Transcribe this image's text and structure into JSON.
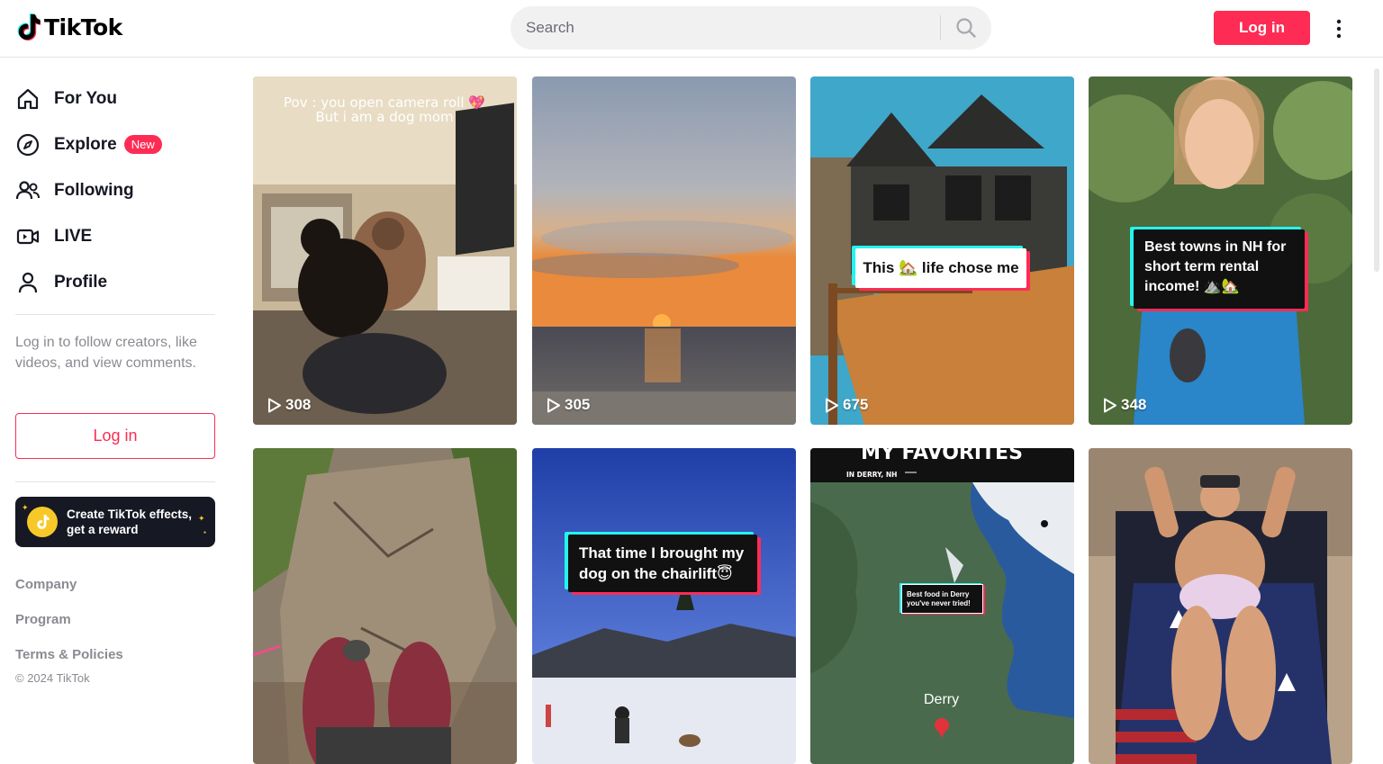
{
  "header": {
    "logo_text": "TikTok",
    "search_placeholder": "Search",
    "login_label": "Log in"
  },
  "sidebar": {
    "nav": [
      {
        "label": "For You",
        "icon": "home-icon"
      },
      {
        "label": "Explore",
        "icon": "compass-icon",
        "badge": "New"
      },
      {
        "label": "Following",
        "icon": "following-icon"
      },
      {
        "label": "LIVE",
        "icon": "live-icon"
      },
      {
        "label": "Profile",
        "icon": "profile-icon"
      }
    ],
    "login_prompt": "Log in to follow creators, like videos, and view comments.",
    "login_label": "Log in",
    "effects_line1": "Create TikTok effects,",
    "effects_line2": "get a reward",
    "footer_links": [
      "Company",
      "Program",
      "Terms & Policies"
    ],
    "copyright": "© 2024 TikTok"
  },
  "videos": [
    {
      "views": "308",
      "caption_line1": "Pov : you open camera roll 💖",
      "caption_line2": "But i am a dog mom"
    },
    {
      "views": "305"
    },
    {
      "views": "675",
      "caption": "This 🏡 life chose me"
    },
    {
      "views": "348",
      "caption_line1": "Best towns in NH for",
      "caption_line2": "short term rental",
      "caption_line3": "income! ⛰️🏡"
    },
    {},
    {
      "caption_line1": "That time I brought my",
      "caption_line2": "dog on the chairlift😇"
    },
    {
      "header_text": "MY FAVORITES",
      "subheader_text": "IN DERRY, NH",
      "caption_line1": "Best food in Derry",
      "caption_line2": "you've never tried!",
      "place_label": "Derry"
    },
    {}
  ],
  "colors": {
    "accent": "#fe2c55",
    "text": "#161823",
    "muted": "#8a8b91"
  }
}
